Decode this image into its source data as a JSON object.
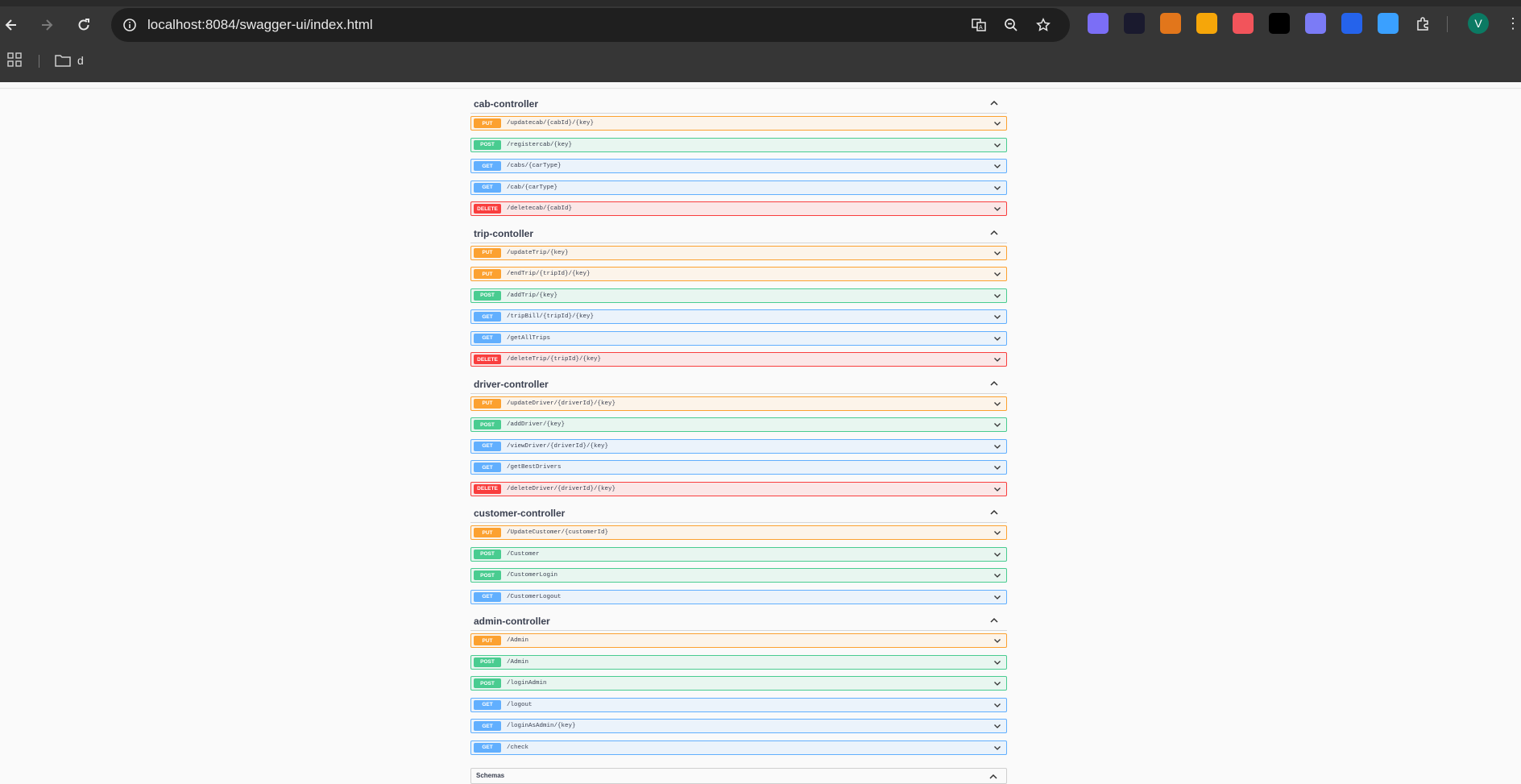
{
  "browser": {
    "url": "localhost:8084/swagger-ui/index.html",
    "avatar_letter": "V",
    "bookmarks": [
      {
        "label": "d"
      }
    ],
    "extensions": [
      {
        "name": "ghost-extension-icon",
        "color": "#7b6ef6"
      },
      {
        "name": "mc-extension-icon",
        "color": "#1a1a2e"
      },
      {
        "name": "metamask-extension-icon",
        "color": "#e2761b"
      },
      {
        "name": "orange-extension-icon",
        "color": "#f6a609"
      },
      {
        "name": "pink-extension-icon",
        "color": "#f2545b"
      },
      {
        "name": "okx-extension-icon",
        "color": "#000000"
      },
      {
        "name": "rabby-extension-icon",
        "color": "#7b7bf6"
      },
      {
        "name": "k-extension-icon",
        "color": "#2563eb"
      },
      {
        "name": "drop-extension-icon",
        "color": "#3aa0ff"
      }
    ]
  },
  "sections": [
    {
      "title": "cab-controller",
      "ops": [
        {
          "method": "PUT",
          "path": "/updatecab/{cabId}/{key}"
        },
        {
          "method": "POST",
          "path": "/registercab/{key}"
        },
        {
          "method": "GET",
          "path": "/cabs/{carType}"
        },
        {
          "method": "GET",
          "path": "/cab/{carType}"
        },
        {
          "method": "DELETE",
          "path": "/deletecab/{cabId}"
        }
      ]
    },
    {
      "title": "trip-contoller",
      "ops": [
        {
          "method": "PUT",
          "path": "/updateTrip/{key}"
        },
        {
          "method": "PUT",
          "path": "/endTrip/{tripId}/{key}"
        },
        {
          "method": "POST",
          "path": "/addTrip/{key}"
        },
        {
          "method": "GET",
          "path": "/tripBill/{tripId}/{key}"
        },
        {
          "method": "GET",
          "path": "/getAllTrips"
        },
        {
          "method": "DELETE",
          "path": "/deleteTrip/{tripId}/{key}"
        }
      ]
    },
    {
      "title": "driver-controller",
      "ops": [
        {
          "method": "PUT",
          "path": "/updateDriver/{driverId}/{key}"
        },
        {
          "method": "POST",
          "path": "/addDriver/{key}"
        },
        {
          "method": "GET",
          "path": "/viewDriver/{driverId}/{key}"
        },
        {
          "method": "GET",
          "path": "/getBestDrivers"
        },
        {
          "method": "DELETE",
          "path": "/deleteDriver/{driverId}/{key}"
        }
      ]
    },
    {
      "title": "customer-controller",
      "ops": [
        {
          "method": "PUT",
          "path": "/UpdateCustomer/{customerId}"
        },
        {
          "method": "POST",
          "path": "/Customer"
        },
        {
          "method": "POST",
          "path": "/CustomerLogin"
        },
        {
          "method": "GET",
          "path": "/CustomerLogout"
        }
      ]
    },
    {
      "title": "admin-controller",
      "ops": [
        {
          "method": "PUT",
          "path": "/Admin"
        },
        {
          "method": "POST",
          "path": "/Admin"
        },
        {
          "method": "POST",
          "path": "/loginAdmin"
        },
        {
          "method": "GET",
          "path": "/logout"
        },
        {
          "method": "GET",
          "path": "/loginAsAdmin/{key}"
        },
        {
          "method": "GET",
          "path": "/check"
        }
      ]
    }
  ],
  "schemas": {
    "title": "Schemas"
  }
}
